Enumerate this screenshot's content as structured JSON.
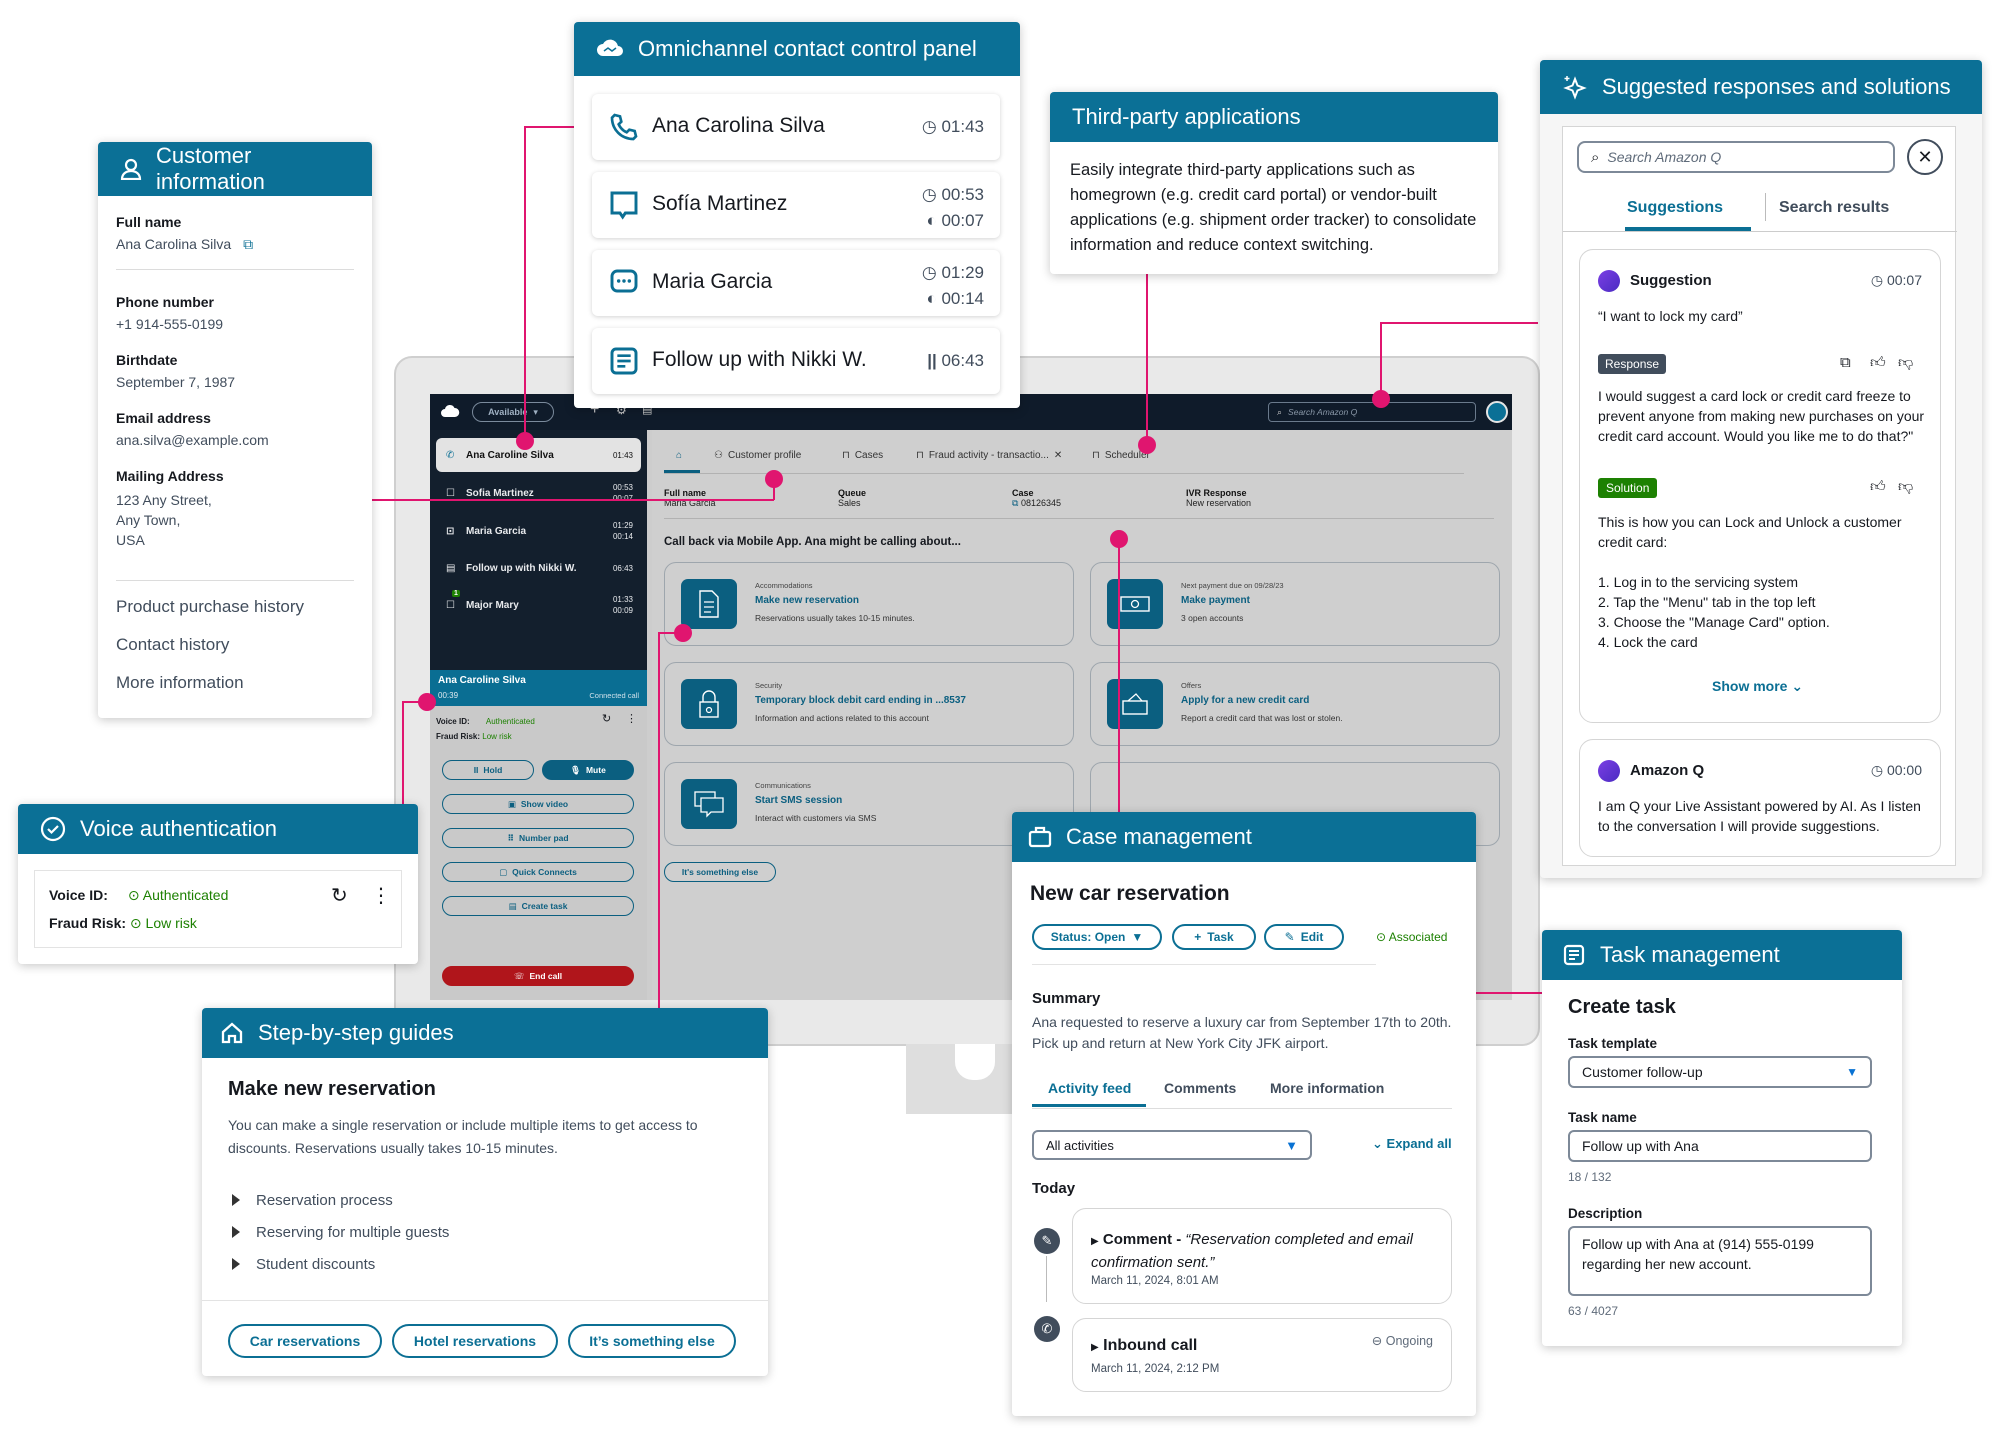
{
  "customer_info": {
    "title": "Customer information",
    "fields": [
      {
        "label": "Full name",
        "value": "Ana Carolina Silva"
      },
      {
        "label": "Phone number",
        "value": "+1 914-555-0199"
      },
      {
        "label": "Birthdate",
        "value": "September 7, 1987"
      },
      {
        "label": "Email address",
        "value": "ana.silva@example.com"
      },
      {
        "label": "Mailing Address",
        "value_lines": [
          "123 Any Street,",
          "Any Town,",
          "USA"
        ]
      }
    ],
    "links": [
      "Product purchase history",
      "Contact history",
      "More information"
    ]
  },
  "omnichannel": {
    "title": "Omnichannel contact control panel",
    "contacts": [
      {
        "name": "Ana Carolina Silva",
        "icon": "phone-icon",
        "timer": "01:43",
        "hold": null,
        "paused": false
      },
      {
        "name": "Sofía Martinez",
        "icon": "chat-bubble-icon",
        "timer": "00:53",
        "hold": "00:07",
        "paused": false
      },
      {
        "name": "Maria Garcia",
        "icon": "chat-dots-icon",
        "timer": "01:29",
        "hold": "00:14",
        "paused": false
      },
      {
        "name": "Follow up with Nikki W.",
        "icon": "task-icon",
        "timer": "06:43",
        "hold": null,
        "paused": true
      }
    ]
  },
  "third_party": {
    "title": "Third-party applications",
    "body": "Easily integrate third-party applications such as homegrown (e.g. credit card portal) or vendor-built applications (e.g. shipment order tracker) to consolidate information and reduce context switching."
  },
  "suggested": {
    "title": "Suggested responses and solutions",
    "search_placeholder": "Search Amazon Q",
    "tabs": [
      "Suggestions",
      "Search results"
    ],
    "active_tab": "Suggestions",
    "suggestion": {
      "label": "Suggestion",
      "time": "00:07",
      "quote": "“I want to lock my card”",
      "response_badge": "Response",
      "response_text": "I would suggest a card lock or credit card freeze to prevent anyone from making new purchases on your credit card account. Would you like me to do that?\"",
      "solution_badge": "Solution",
      "solution_intro": "This is how you can Lock and Unlock a customer credit card:",
      "steps": [
        "1. Log in to the servicing system",
        "2. Tap the \"Menu\" tab in the top left",
        "3. Choose the \"Manage Card\" option.",
        "4. Lock the card"
      ],
      "show_more": "Show more"
    },
    "amazon_q": {
      "label": "Amazon Q",
      "time": "00:00",
      "text": "I am Q your Live Assistant powered by AI. As I listen to the conversation I will provide suggestions."
    }
  },
  "voice_auth": {
    "title": "Voice authentication",
    "voice_id_label": "Voice ID:",
    "voice_id_value": "Authenticated",
    "fraud_label": "Fraud Risk:",
    "fraud_value": "Low risk"
  },
  "guides": {
    "title": "Step-by-step guides",
    "heading": "Make new reservation",
    "body": "You can make a single reservation or include multiple items to get access to discounts. Reservations usually takes 10-15 minutes.",
    "items": [
      "Reservation process",
      "Reserving for multiple guests",
      "Student discounts"
    ],
    "buttons": [
      "Car reservations",
      "Hotel reservations",
      "It’s something else"
    ]
  },
  "case_mgmt": {
    "title": "Case management",
    "heading": "New car reservation",
    "status_button": "Status: Open",
    "task_button": "Task",
    "edit_button": "Edit",
    "associated": "Associated",
    "summary_label": "Summary",
    "summary": "Ana requested to reserve a luxury car from September 17th to 20th. Pick up and return at New York City JFK airport.",
    "tabs": [
      "Activity feed",
      "Comments",
      "More information"
    ],
    "active_tab": "Activity feed",
    "filter_value": "All activities",
    "expand_all": "Expand all",
    "group": "Today",
    "activities": [
      {
        "title": "Comment -",
        "quote": "“Reservation completed and email confirmation sent.”",
        "time": "March 11, 2024, 8:01 AM",
        "status": null
      },
      {
        "title": "Inbound call",
        "quote": null,
        "time": "March 11, 2024, 2:12 PM",
        "status": "Ongoing"
      }
    ]
  },
  "task_mgmt": {
    "title": "Task management",
    "heading": "Create task",
    "template_label": "Task template",
    "template_value": "Customer follow-up",
    "name_label": "Task name",
    "name_value": "Follow up with Ana",
    "name_count": "18 / 132",
    "desc_label": "Description",
    "desc_value": "Follow up with Ana at (914) 555-0199 regarding her new account.",
    "desc_count": "63 / 4027"
  },
  "screen": {
    "status": "Available",
    "search_placeholder": "Search Amazon Q",
    "contacts": [
      {
        "name": "Ana Caroline Silva",
        "icon": "phone-icon",
        "t1": "01:43",
        "t2": null
      },
      {
        "name": "Sofia Martinez",
        "icon": "chat-bubble-icon",
        "t1": "00:53",
        "t2": "00:07"
      },
      {
        "name": "Maria Garcia",
        "icon": "chat-dots-icon",
        "t1": "01:29",
        "t2": "00:14"
      },
      {
        "name": "Follow up with Nikki W.",
        "icon": "task-icon",
        "t1": "06:43",
        "t2": null
      },
      {
        "name": "Major Mary",
        "icon": "chat-bubble-icon",
        "t1": "01:33",
        "t2": "00:09",
        "badge": "1"
      }
    ],
    "call": {
      "name": "Ana Caroline Silva",
      "timer": "00:39",
      "state": "Connected call",
      "voice_id_label": "Voice ID:",
      "voice_id_value": "Authenticated",
      "fraud_label": "Fraud Risk:",
      "fraud_value": "Low risk",
      "buttons": {
        "hold": "Hold",
        "mute": "Mute",
        "video": "Show video",
        "numpad": "Number pad",
        "quick": "Quick Connects",
        "task": "Create task",
        "end": "End call"
      }
    },
    "tabs": [
      "Customer profile",
      "Cases",
      "Fraud activity - transactio...",
      "Scheduler"
    ],
    "info": [
      {
        "label": "Full name",
        "value": "Maria Garcia"
      },
      {
        "label": "Queue",
        "value": "Sales"
      },
      {
        "label": "Case",
        "value": "08126345"
      },
      {
        "label": "IVR Response",
        "value": "New reservation"
      }
    ],
    "prompt": "Call back via Mobile App. Ana might be calling about...",
    "tiles": [
      {
        "category": "Accommodations",
        "title": "Make new reservation",
        "desc": "Reservations usually takes 10-15 minutes."
      },
      {
        "category": "Next payment due on 09/28/23",
        "title": "Make payment",
        "desc": "3 open accounts"
      },
      {
        "category": "Security",
        "title": "Temporary block debit card ending in ...8537",
        "desc": "Information and actions related to this account"
      },
      {
        "category": "Offers",
        "title": "Apply for a new credit card",
        "desc": "Report a credit card that was lost or stolen."
      },
      {
        "category": "Communications",
        "title": "Start SMS session",
        "desc": "Interact with customers via SMS"
      }
    ],
    "something_else": "It's something else"
  },
  "colors": {
    "brand_teal": "#0b7096",
    "connector": "#e0156f",
    "success": "#1d8102",
    "end_call": "#b0151b",
    "nav_dark": "#0f1b2a"
  }
}
